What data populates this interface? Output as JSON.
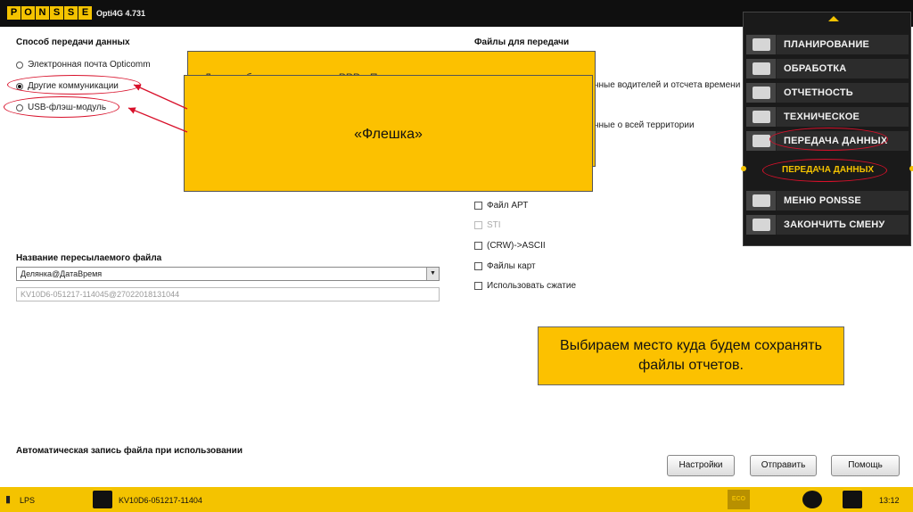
{
  "app": {
    "logo_letters": [
      "P",
      "O",
      "N",
      "S",
      "S",
      "E"
    ],
    "title": "Opti4G 4.731"
  },
  "left": {
    "method_label": "Способ передачи данных",
    "options": [
      {
        "label": "Электронная почта Opticomm",
        "selected": false
      },
      {
        "label": "Другие коммуникации",
        "selected": true
      },
      {
        "label": "USB-флэш-модуль",
        "selected": false
      }
    ],
    "filename_label": "Название пересылаемого файла",
    "filename_select": "Делянка@ДатаВремя",
    "filename_value": "KV10D6-051217-114045@27022018131044"
  },
  "right": {
    "files_label": "Файлы для передачи",
    "partial_texts": [
      "нные водителей и отсчета времени",
      "нные о всей территории"
    ],
    "checkboxes": [
      {
        "label": "Файл АРТ",
        "disabled": false
      },
      {
        "label": "STI",
        "disabled": true
      },
      {
        "label": "(CRW)->ASCII",
        "disabled": false
      },
      {
        "label": "Файлы карт",
        "disabled": false
      },
      {
        "label": "Использовать сжатие",
        "disabled": false
      }
    ]
  },
  "overlay": {
    "partial_text": "Данные буду.. отправлены РРР... Подкл...",
    "flash_text": "«Флешка»",
    "callout_text": "Выбираем место куда будем сохранять файлы отчетов."
  },
  "auto_save_label": "Автоматическая запись файла при использовании",
  "buttons": {
    "settings": "Настройки",
    "send": "Отправить",
    "help": "Помощь"
  },
  "menu": {
    "items": [
      {
        "label": "ПЛАНИРОВАНИЕ",
        "icon": "planning-icon"
      },
      {
        "label": "ОБРАБОТКА",
        "icon": "processing-icon"
      },
      {
        "label": "ОТЧЕТНОСТЬ",
        "icon": "reports-icon"
      },
      {
        "label": "ТЕХНИЧЕСКОЕ",
        "icon": "technical-icon"
      },
      {
        "label": "ПЕРЕДАЧА ДАННЫХ",
        "icon": "data-transfer-icon"
      }
    ],
    "sub_item": "ПЕРЕДАЧА ДАННЫХ",
    "bottom_items": [
      {
        "label": "МЕНЮ PONSSE",
        "icon": "ponsse-menu-icon"
      },
      {
        "label": "ЗАКОНЧИТЬ СМЕНУ",
        "icon": "end-shift-icon"
      }
    ]
  },
  "statusbar": {
    "lps": "LPS",
    "stand": "KV10D6-051217-11404",
    "eco": "ECO",
    "time": "13:12"
  },
  "colors": {
    "accent_yellow": "#f4c300",
    "dark": "#0f0f0f",
    "annotation_red": "#d8102a"
  }
}
